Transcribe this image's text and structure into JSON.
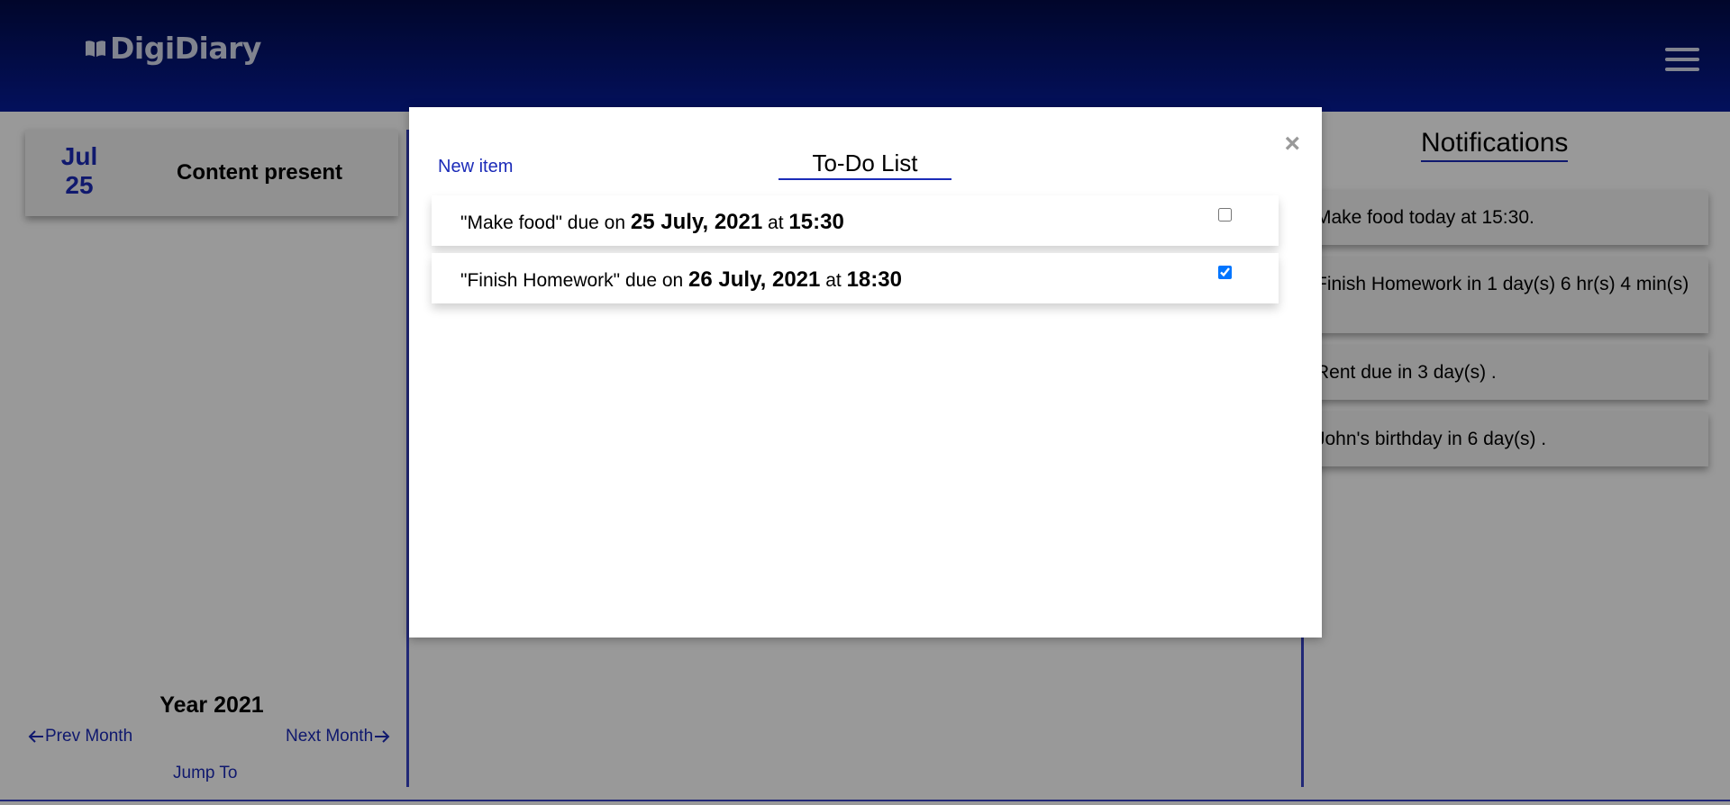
{
  "header": {
    "logo": "DigiDiary"
  },
  "left_panel": {
    "date_card": {
      "month": "Jul",
      "day": "25",
      "content": "Content present"
    },
    "year": "Year 2021",
    "prev_month": "Prev Month",
    "next_month": "Next Month",
    "jump_to": "Jump To"
  },
  "notifications": {
    "title": "Notifications",
    "items": [
      "Make food today at 15:30.",
      "Finish Homework in 1 day(s) 6 hr(s) 4 min(s) .",
      "Rent due in 3 day(s) .",
      "John's birthday in 6 day(s) ."
    ]
  },
  "modal": {
    "close": "×",
    "new_item": "New item",
    "title": "To-Do List",
    "items": [
      {
        "name": "\"Make food\"",
        "due_word": " due on ",
        "date": "25 July, 2021",
        "at_word": " at ",
        "time": "15:30",
        "checked": false
      },
      {
        "name": "\"Finish Homework\"",
        "due_word": " due on ",
        "date": "26 July, 2021",
        "at_word": " at ",
        "time": "18:30",
        "checked": true
      }
    ]
  },
  "colors": {
    "accent": "#1b2bb8",
    "header_top": "#020b48",
    "header_bottom": "#061c9a"
  }
}
